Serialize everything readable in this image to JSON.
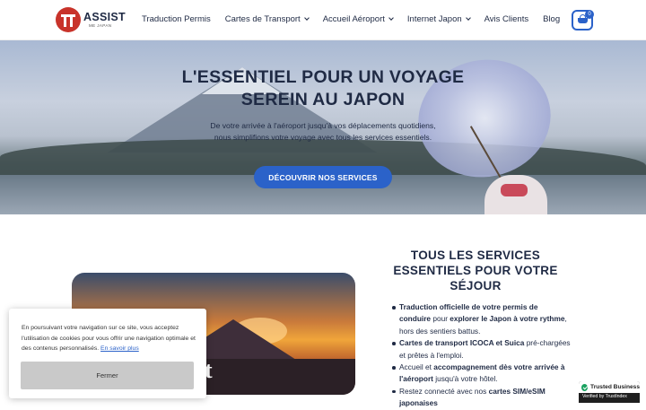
{
  "brand": {
    "name": "ASSIST",
    "tagline": "ME JAPAN"
  },
  "nav": {
    "items": [
      {
        "label": "Traduction Permis",
        "dropdown": false
      },
      {
        "label": "Cartes de Transport",
        "dropdown": true
      },
      {
        "label": "Accueil Aéroport",
        "dropdown": true
      },
      {
        "label": "Internet Japon",
        "dropdown": true
      },
      {
        "label": "Avis Clients",
        "dropdown": false
      },
      {
        "label": "Blog",
        "dropdown": false
      }
    ],
    "cart_count": "0"
  },
  "hero": {
    "title_line1": "L'ESSENTIEL POUR UN VOYAGE",
    "title_line2": "SEREIN AU JAPON",
    "subtitle_line1": "De votre arrivée à l'aéroport jusqu'à vos déplacements quotidiens,",
    "subtitle_line2": "nous simplifions votre voyage avec tous les services essentiels.",
    "cta": "DÉCOUVRIR NOS SERVICES"
  },
  "services": {
    "title_line1": "TOUS LES SERVICES",
    "title_line2": "ESSENTIELS POUR VOTRE",
    "title_line3": "SÉJOUR",
    "items": [
      {
        "b1": "Traduction officielle de votre permis de conduire",
        "t1": " pour ",
        "b2": "explorer le Japon à votre rythme",
        "t2": ", hors des sentiers battus."
      },
      {
        "b1": "Cartes de transport ICOCA et Suica",
        "t1": " pré-chargées et prêtes à l'emploi.",
        "b2": "",
        "t2": ""
      },
      {
        "b1": "",
        "t1": "Accueil et ",
        "b2": "accompagnement dès votre arrivée à l'aéroport",
        "t2": " jusqu'à votre hôtel."
      },
      {
        "b1": "",
        "t1": "Restez connecté avec nos ",
        "b2": "cartes SIM/eSIM japonaises",
        "t2": ""
      }
    ],
    "photo_overlay_letter": "t"
  },
  "cookie": {
    "text": "En poursuivant votre navigation sur ce site, vous acceptez l'utilisation de cookies pour vous offrir une navigation optimale et des contenus personnalisés.",
    "link": "En savoir plus",
    "button": "Fermer"
  },
  "trust_badge": {
    "title": "Trusted Business",
    "subtitle": "Verified by TrustIndex"
  },
  "colors": {
    "accent": "#2b62c9",
    "text": "#1f2a44",
    "brand_red": "#c8332a"
  }
}
